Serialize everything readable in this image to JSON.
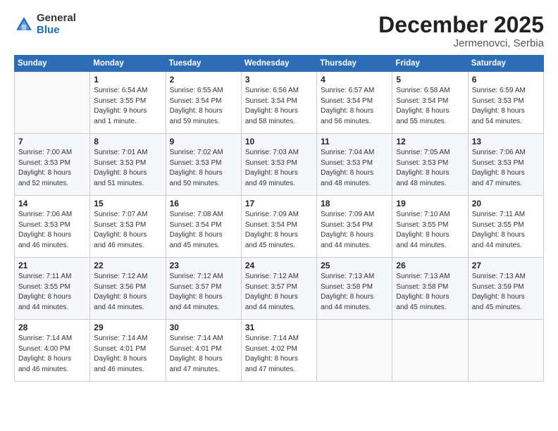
{
  "logo": {
    "general": "General",
    "blue": "Blue"
  },
  "header": {
    "month": "December 2025",
    "location": "Jermenovci, Serbia"
  },
  "weekdays": [
    "Sunday",
    "Monday",
    "Tuesday",
    "Wednesday",
    "Thursday",
    "Friday",
    "Saturday"
  ],
  "weeks": [
    [
      {
        "day": "",
        "info": ""
      },
      {
        "day": "1",
        "info": "Sunrise: 6:54 AM\nSunset: 3:55 PM\nDaylight: 9 hours\nand 1 minute."
      },
      {
        "day": "2",
        "info": "Sunrise: 6:55 AM\nSunset: 3:54 PM\nDaylight: 8 hours\nand 59 minutes."
      },
      {
        "day": "3",
        "info": "Sunrise: 6:56 AM\nSunset: 3:54 PM\nDaylight: 8 hours\nand 58 minutes."
      },
      {
        "day": "4",
        "info": "Sunrise: 6:57 AM\nSunset: 3:54 PM\nDaylight: 8 hours\nand 56 minutes."
      },
      {
        "day": "5",
        "info": "Sunrise: 6:58 AM\nSunset: 3:54 PM\nDaylight: 8 hours\nand 55 minutes."
      },
      {
        "day": "6",
        "info": "Sunrise: 6:59 AM\nSunset: 3:53 PM\nDaylight: 8 hours\nand 54 minutes."
      }
    ],
    [
      {
        "day": "7",
        "info": "Sunrise: 7:00 AM\nSunset: 3:53 PM\nDaylight: 8 hours\nand 52 minutes."
      },
      {
        "day": "8",
        "info": "Sunrise: 7:01 AM\nSunset: 3:53 PM\nDaylight: 8 hours\nand 51 minutes."
      },
      {
        "day": "9",
        "info": "Sunrise: 7:02 AM\nSunset: 3:53 PM\nDaylight: 8 hours\nand 50 minutes."
      },
      {
        "day": "10",
        "info": "Sunrise: 7:03 AM\nSunset: 3:53 PM\nDaylight: 8 hours\nand 49 minutes."
      },
      {
        "day": "11",
        "info": "Sunrise: 7:04 AM\nSunset: 3:53 PM\nDaylight: 8 hours\nand 48 minutes."
      },
      {
        "day": "12",
        "info": "Sunrise: 7:05 AM\nSunset: 3:53 PM\nDaylight: 8 hours\nand 48 minutes."
      },
      {
        "day": "13",
        "info": "Sunrise: 7:06 AM\nSunset: 3:53 PM\nDaylight: 8 hours\nand 47 minutes."
      }
    ],
    [
      {
        "day": "14",
        "info": "Sunrise: 7:06 AM\nSunset: 3:53 PM\nDaylight: 8 hours\nand 46 minutes."
      },
      {
        "day": "15",
        "info": "Sunrise: 7:07 AM\nSunset: 3:53 PM\nDaylight: 8 hours\nand 46 minutes."
      },
      {
        "day": "16",
        "info": "Sunrise: 7:08 AM\nSunset: 3:54 PM\nDaylight: 8 hours\nand 45 minutes."
      },
      {
        "day": "17",
        "info": "Sunrise: 7:09 AM\nSunset: 3:54 PM\nDaylight: 8 hours\nand 45 minutes."
      },
      {
        "day": "18",
        "info": "Sunrise: 7:09 AM\nSunset: 3:54 PM\nDaylight: 8 hours\nand 44 minutes."
      },
      {
        "day": "19",
        "info": "Sunrise: 7:10 AM\nSunset: 3:55 PM\nDaylight: 8 hours\nand 44 minutes."
      },
      {
        "day": "20",
        "info": "Sunrise: 7:11 AM\nSunset: 3:55 PM\nDaylight: 8 hours\nand 44 minutes."
      }
    ],
    [
      {
        "day": "21",
        "info": "Sunrise: 7:11 AM\nSunset: 3:55 PM\nDaylight: 8 hours\nand 44 minutes."
      },
      {
        "day": "22",
        "info": "Sunrise: 7:12 AM\nSunset: 3:56 PM\nDaylight: 8 hours\nand 44 minutes."
      },
      {
        "day": "23",
        "info": "Sunrise: 7:12 AM\nSunset: 3:57 PM\nDaylight: 8 hours\nand 44 minutes."
      },
      {
        "day": "24",
        "info": "Sunrise: 7:12 AM\nSunset: 3:57 PM\nDaylight: 8 hours\nand 44 minutes."
      },
      {
        "day": "25",
        "info": "Sunrise: 7:13 AM\nSunset: 3:58 PM\nDaylight: 8 hours\nand 44 minutes."
      },
      {
        "day": "26",
        "info": "Sunrise: 7:13 AM\nSunset: 3:58 PM\nDaylight: 8 hours\nand 45 minutes."
      },
      {
        "day": "27",
        "info": "Sunrise: 7:13 AM\nSunset: 3:59 PM\nDaylight: 8 hours\nand 45 minutes."
      }
    ],
    [
      {
        "day": "28",
        "info": "Sunrise: 7:14 AM\nSunset: 4:00 PM\nDaylight: 8 hours\nand 46 minutes."
      },
      {
        "day": "29",
        "info": "Sunrise: 7:14 AM\nSunset: 4:01 PM\nDaylight: 8 hours\nand 46 minutes."
      },
      {
        "day": "30",
        "info": "Sunrise: 7:14 AM\nSunset: 4:01 PM\nDaylight: 8 hours\nand 47 minutes."
      },
      {
        "day": "31",
        "info": "Sunrise: 7:14 AM\nSunset: 4:02 PM\nDaylight: 8 hours\nand 47 minutes."
      },
      {
        "day": "",
        "info": ""
      },
      {
        "day": "",
        "info": ""
      },
      {
        "day": "",
        "info": ""
      }
    ]
  ]
}
